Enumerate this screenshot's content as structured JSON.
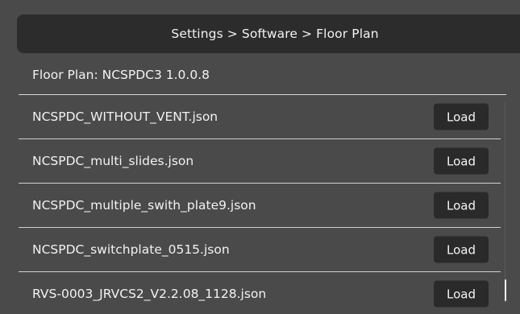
{
  "header": {
    "breadcrumb": "Settings > Software > Floor Plan"
  },
  "floor_plan": {
    "label": "Floor Plan: NCSPDC3 1.0.0.8"
  },
  "files": [
    {
      "name": "NCSPDC_WITHOUT_VENT.json",
      "button": "Load"
    },
    {
      "name": "NCSPDC_multi_slides.json",
      "button": "Load"
    },
    {
      "name": "NCSPDC_multiple_swith_plate9.json",
      "button": "Load"
    },
    {
      "name": "NCSPDC_switchplate_0515.json",
      "button": "Load"
    },
    {
      "name": "RVS-0003_JRVCS2_V2.2.08_1128.json",
      "button": "Load"
    }
  ]
}
